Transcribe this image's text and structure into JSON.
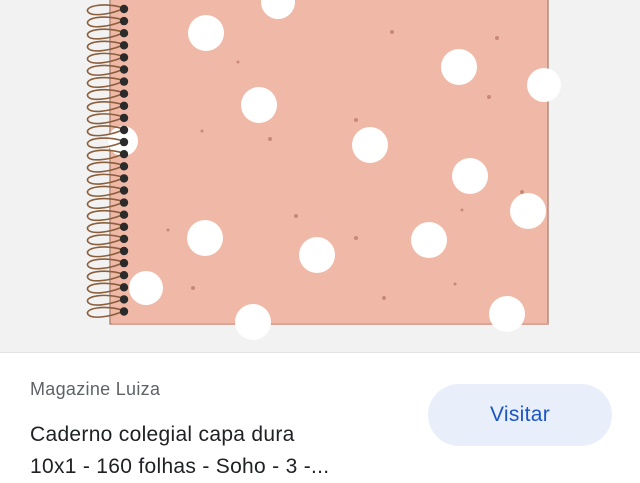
{
  "product": {
    "image_alt": "Caderno colegial capa dura com bolinhas",
    "cover_color": "#f0b9a7",
    "dot_color": "#ffffff",
    "speck_color": "#c9897a",
    "spiral_color": "#8b5e3c"
  },
  "result": {
    "source": "Magazine Luiza",
    "title_line1": "Caderno colegial capa dura",
    "title_line2": "10x1 - 160 folhas - Soho - 3 -..."
  },
  "actions": {
    "visit_label": "Visitar"
  },
  "colors": {
    "accent": "#1a56c4",
    "button_bg": "#e8eefa"
  }
}
